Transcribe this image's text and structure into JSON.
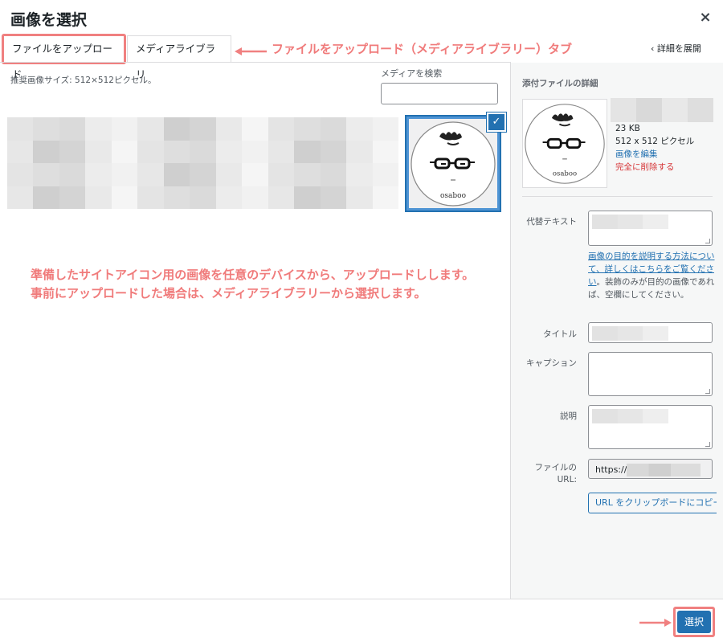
{
  "modal": {
    "title": "画像を選択",
    "close_label": "×"
  },
  "tabs": [
    {
      "label": "ファイルをアップロード",
      "active": true
    },
    {
      "label": "メディアライブラリ",
      "active": false
    }
  ],
  "annotations": {
    "tab_note": "ファイルをアップロード（メディアライブラリー）タブ",
    "body_line1": "準備したサイトアイコン用の画像を任意のデバイスから、アップロードしします。",
    "body_line2": "事前にアップロードした場合は、メディアライブラリーから選択します。",
    "color": "#f07b7b"
  },
  "header": {
    "expand_details": "‹ 詳細を展開"
  },
  "library": {
    "recommended_size": "推奨画像サイズ: 512×512ピクセル。",
    "search_label": "メディアを検索",
    "search_value": "",
    "selected_thumb_caption": "osaboo"
  },
  "details": {
    "heading": "添付ファイルの詳細",
    "file_size": "23 KB",
    "dimensions": "512 x 512 ピクセル",
    "edit_link": "画像を編集",
    "delete_link": "完全に削除する",
    "alt_label": "代替テキスト",
    "alt_value": "",
    "alt_help_link": "画像の目的を説明する方法について、詳しくはこちらをご覧ください",
    "alt_help_rest": "。装飾のみが目的の画像であれば、空欄にしてください。",
    "title_label": "タイトル",
    "title_value": "",
    "caption_label": "キャプション",
    "caption_value": "",
    "description_label": "説明",
    "description_value": "",
    "url_label_line1": "ファイルの",
    "url_label_line2": "URL:",
    "url_value": "https://",
    "copy_button": "URL をクリップボードにコピー"
  },
  "footer": {
    "select_button": "選択"
  },
  "colors": {
    "accent": "#2271b1",
    "annotation_red": "#f08080",
    "danger": "#d63638"
  }
}
